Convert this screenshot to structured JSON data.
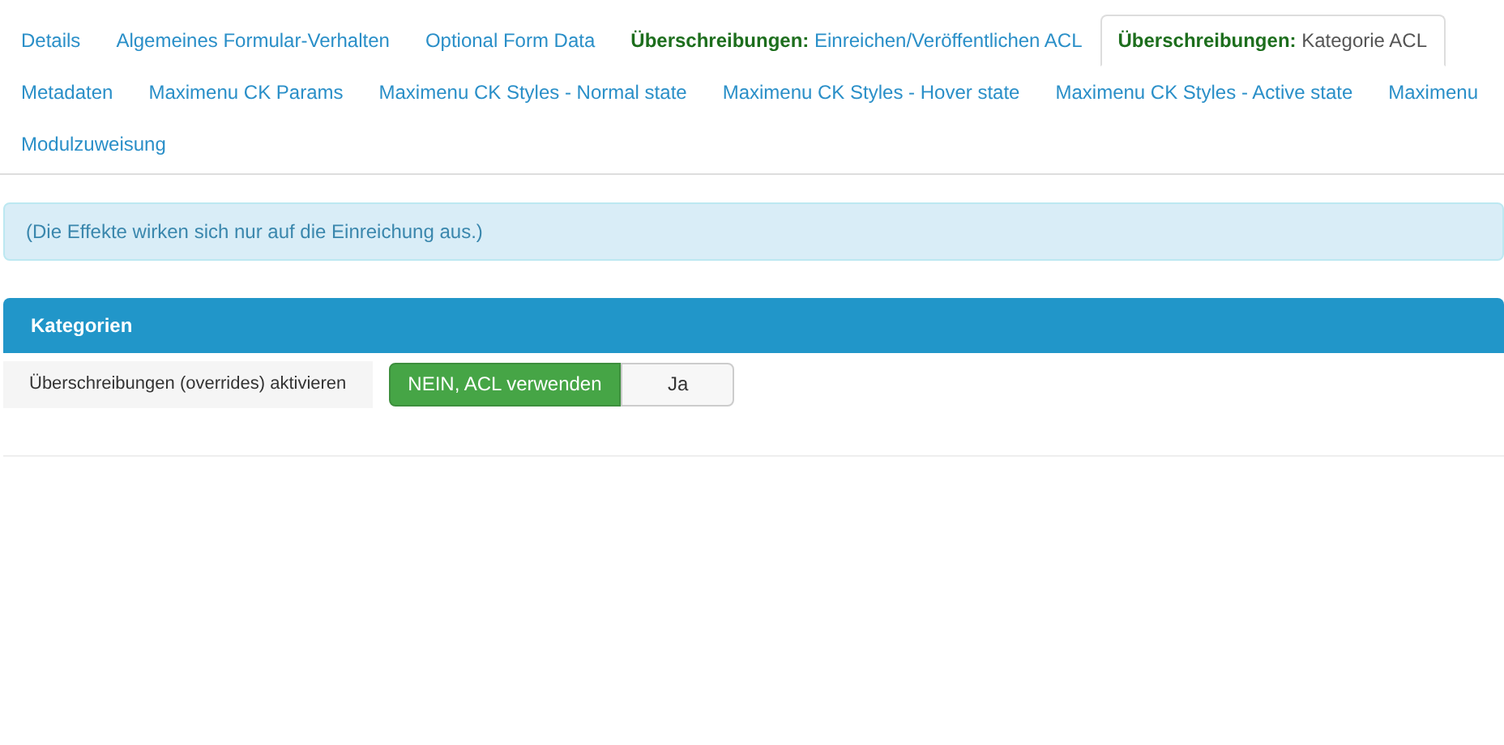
{
  "tab_rows": [
    [
      {
        "label": "Details",
        "selected": false
      },
      {
        "label": "Algemeines Formular-Verhalten",
        "selected": false
      },
      {
        "label": "Optional Form Data",
        "selected": false
      },
      {
        "prefix": "Überschreibungen:",
        "label": "Einreichen/Veröffentlichen ACL",
        "selected": false
      },
      {
        "prefix": "Überschreibungen:",
        "label": "Kategorie ACL",
        "selected": true
      }
    ],
    [
      {
        "label": "Metadaten",
        "selected": false
      },
      {
        "label": "Maximenu CK Params",
        "selected": false
      },
      {
        "label": "Maximenu CK Styles - Normal state",
        "selected": false
      },
      {
        "label": "Maximenu CK Styles - Hover state",
        "selected": false
      },
      {
        "label": "Maximenu CK Styles - Active state",
        "selected": false
      },
      {
        "label": "Maximenu",
        "selected": false
      }
    ],
    [
      {
        "label": "Modulzuweisung",
        "selected": false
      }
    ]
  ],
  "info": "(Die Effekte wirken sich nur auf die Einreichung aus.)",
  "panel": {
    "title": "Kategorien",
    "field": {
      "label": "Überschreibungen (overrides) aktivieren",
      "options": [
        {
          "label": "NEIN, ACL verwenden",
          "selected": true
        },
        {
          "label": "Ja",
          "selected": false
        }
      ]
    }
  }
}
